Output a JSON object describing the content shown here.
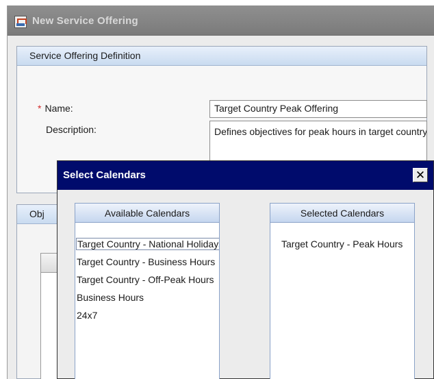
{
  "window": {
    "title": "New Service Offering"
  },
  "definition": {
    "header": "Service Offering Definition",
    "name_label": "Name:",
    "required_marker": "*",
    "name_value": "Target Country Peak Offering",
    "description_label": "Description:",
    "description_value": "Defines objectives for peak hours in target country"
  },
  "objectives": {
    "header_visible": "Obj"
  },
  "dialog": {
    "title": "Select Calendars",
    "close_glyph": "✕",
    "available": {
      "header": "Available Calendars",
      "items": [
        "Target Country - National Holidays",
        "Target Country - Business Hours",
        "Target Country - Off-Peak Hours",
        "Business Hours",
        "24x7"
      ]
    },
    "selected": {
      "header": "Selected Calendars",
      "items": [
        "Target Country - Peak Hours"
      ]
    },
    "add_button_icon": "arrow-right-icon",
    "remove_button_icon": "arrow-left-icon"
  }
}
